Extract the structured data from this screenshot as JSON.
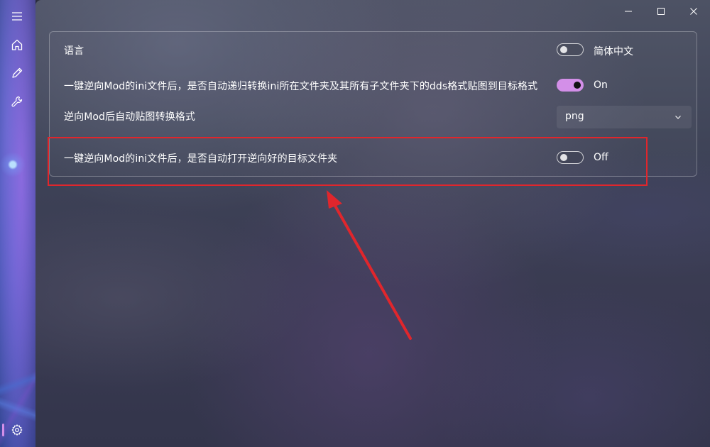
{
  "window": {
    "minimize_icon": "minimize-icon",
    "maximize_icon": "maximize-icon",
    "close_icon": "close-icon"
  },
  "nav": {
    "items": [
      {
        "icon": "menu-icon"
      },
      {
        "icon": "home-icon"
      },
      {
        "icon": "pencil-icon"
      },
      {
        "icon": "wrench-icon"
      },
      {
        "icon": "gear-icon",
        "active": true
      }
    ],
    "accent": "#d38fe8"
  },
  "settings": {
    "language": {
      "label": "语言",
      "toggle_state": false,
      "value_text": "简体中文"
    },
    "auto_convert_dds": {
      "label": "一键逆向Mod的ini文件后，是否自动递归转换ini所在文件夹及其所有子文件夹下的dds格式贴图到目标格式",
      "toggle_state": true,
      "state_text": "On"
    },
    "texture_format": {
      "label": "逆向Mod后自动贴图转换格式",
      "selected": "png"
    },
    "auto_open_folder": {
      "label": "一键逆向Mod的ini文件后，是否自动打开逆向好的目标文件夹",
      "toggle_state": false,
      "state_text": "Off"
    }
  },
  "annotation": {
    "color": "#e0262c"
  }
}
